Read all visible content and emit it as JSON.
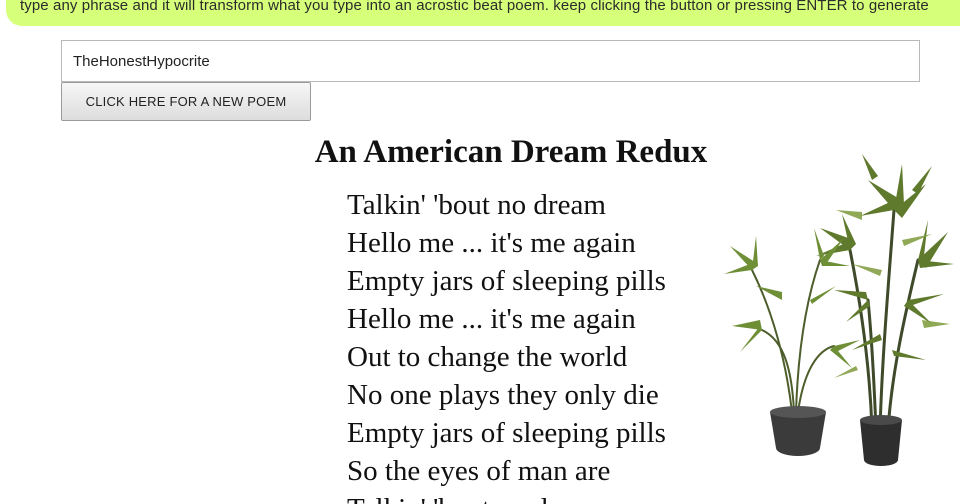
{
  "banner": {
    "text": "type any phrase and it will transform what you type into an acrostic beat poem. keep clicking the button or pressing ENTER to generate"
  },
  "input": {
    "value": "TheHonestHypocrite"
  },
  "button": {
    "label": "CLICK HERE FOR A NEW POEM"
  },
  "poem": {
    "title": "An American Dream Redux",
    "lines": [
      "Talkin' 'bout no dream",
      "Hello me ... it's me again",
      "Empty jars of sleeping pills",
      "Hello me ... it's me again",
      "Out to change the world",
      "No one plays they only die",
      "Empty jars of sleeping pills",
      "So the eyes of man are",
      "Talkin' 'bout no dream"
    ]
  },
  "image": {
    "icon": "potted-plants-image"
  }
}
